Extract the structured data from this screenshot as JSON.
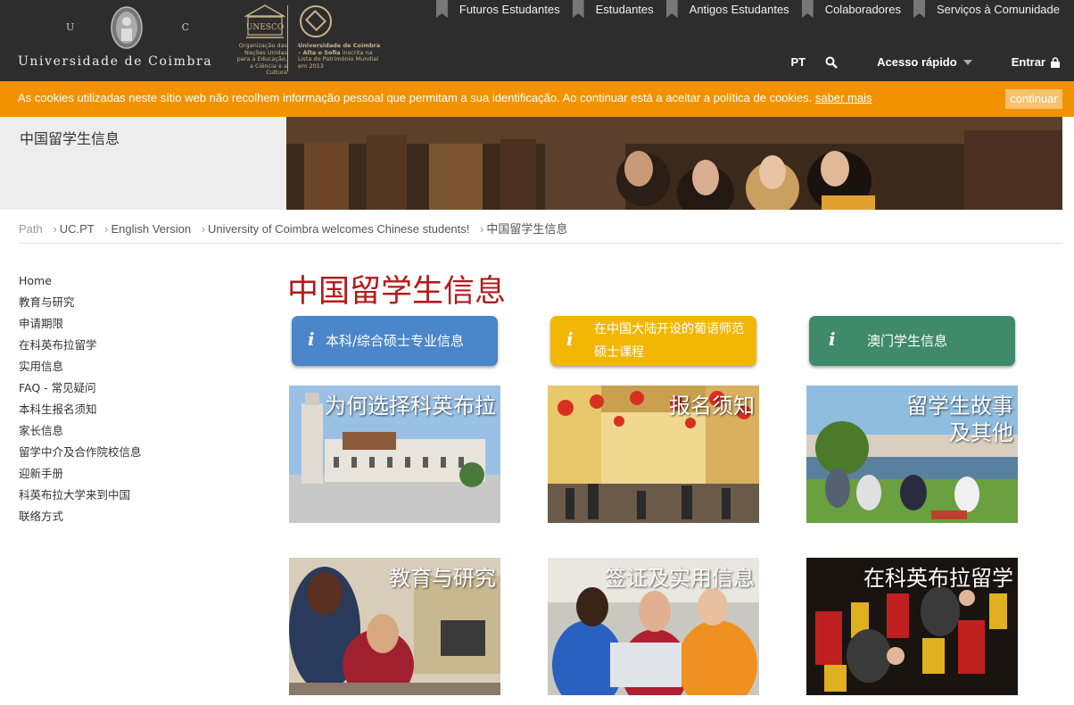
{
  "header": {
    "uc_letters": [
      "U",
      "C"
    ],
    "university_name": "Universidade de Coimbra",
    "unesco_label": "UNESCO",
    "unesco_org_text": "Organização das Nações Unidas para a Educação, a Ciência e a Cultura",
    "unesco_site_title": "Universidade de Coimbra – Alta e Sofia",
    "unesco_site_text": "inscrita na Lista do Património Mundial em 2013",
    "top_nav": [
      "Futuros Estudantes",
      "Estudantes",
      "Antigos Estudantes",
      "Colaboradores",
      "Serviços à Comunidade"
    ],
    "lang": "PT",
    "quick_access": "Acesso rápido",
    "login": "Entrar"
  },
  "cookie": {
    "text": "As cookies utilizadas neste sítio web não recolhem informação pessoal que permitam a sua identificação. Ao continuar está a aceitar a política de cookies.",
    "link": "saber mais",
    "button": "continuar"
  },
  "banner": {
    "title": "中国留学生信息"
  },
  "breadcrumb": {
    "path_label": "Path",
    "items": [
      "UC.PT",
      "English Version",
      "University of Coimbra welcomes Chinese students!",
      "中国留学生信息"
    ]
  },
  "sidebar": [
    "Home",
    "教育与研究",
    "申请期限",
    "在科英布拉留学",
    "实用信息",
    "FAQ - 常见疑问",
    "本科生报名须知",
    "家长信息",
    "留学中介及合作院校信息",
    "迎新手册",
    "科英布拉大学来到中国",
    "联络方式"
  ],
  "main": {
    "title": "中国留学生信息",
    "info_icon": "i",
    "buttons": [
      {
        "label": "本科/综合硕士专业信息",
        "color": "#4a86c9"
      },
      {
        "label": "在中国大陆开设的葡语师范硕士课程",
        "color": "#f2b705"
      },
      {
        "label": "澳门学生信息",
        "color": "#3f8a6a"
      }
    ],
    "tiles": [
      "为何选择科英布拉",
      "报名须知",
      "留学生故事及其他",
      "教育与研究",
      "签证及实用信息",
      "在科英布拉留学"
    ]
  },
  "colors": {
    "header_bg": "#2d2d2d",
    "cookie_bg": "#f39200",
    "title_red": "#b31b1b"
  }
}
